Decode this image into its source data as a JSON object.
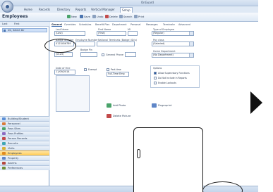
{
  "window": {
    "title": "OnGuard"
  },
  "ribbon": {
    "tabs": [
      "Home",
      "Records",
      "Directory",
      "Reports",
      "Vertical Manager",
      "Setup"
    ],
    "active_tab": "Setup",
    "toolbar": [
      "New",
      "Save",
      "Undo",
      "Delete",
      "Search",
      "Print"
    ]
  },
  "page": {
    "heading": "Employees"
  },
  "sidebar": {
    "header": [
      "Last",
      "First"
    ],
    "tree_selected": "Dir, Select Dir",
    "nav": [
      {
        "label": "Building/Student",
        "color": "#5b8fd6"
      },
      {
        "label": "Personnel",
        "color": "#d97a3a"
      },
      {
        "label": "Pass Sites",
        "color": "#4aa36a"
      },
      {
        "label": "Pass Profiles",
        "color": "#8c6bc2"
      },
      {
        "label": "Person Records",
        "color": "#c24b4b"
      },
      {
        "label": "Recruits",
        "color": "#3fa7b5"
      },
      {
        "label": "Visits",
        "color": "#d6b23a"
      },
      {
        "label": "Employees",
        "color": "#e08a1f",
        "selected": true
      },
      {
        "label": "Property",
        "color": "#5f86c7"
      },
      {
        "label": "Alarms",
        "color": "#b5473f"
      },
      {
        "label": "Preferences",
        "color": "#6f8f3a"
      }
    ]
  },
  "form": {
    "tabs": [
      "General",
      "Overrides",
      "Schedules",
      "Benefit Plan",
      "Department",
      "Personal",
      "Messages",
      "Terminate",
      "Advanced"
    ],
    "active_tab": "General",
    "last_name_label": "Last Name",
    "last_name": "(Last)",
    "first_name_label": "First Name",
    "first_name": "(First)",
    "mi_label": "MI",
    "employee_type_label": "Type of Employee",
    "employee_type": "(Regular)",
    "badge_label": "Badge Number",
    "badge_value": "0123456789",
    "employee_number_label": "Employee Number",
    "national_id_label": "National Terminals (Badge) ID(s)",
    "pay_class_label": "Pay class",
    "pay_class": "(Salaried)",
    "badge_pin_label": "Badge Pin",
    "badge_pin": "(0123)",
    "general_phone_label": "General Phone",
    "home_dept_label": "Home Department",
    "home_dept": "(No Department)",
    "date_of_hire_label": "Date of Hire",
    "date_of_hire": "11/09/2014",
    "exempt_label": "Exempt",
    "part_time_label": "Part-time",
    "full_time_label": "Full-Time Emp",
    "options_title": "Options",
    "options": [
      "Allow Supervisory Functions",
      "Do Not Include in Reports",
      "Enable Lockouts"
    ],
    "add_photo": "Add Photo",
    "delete_picture": "Delete Picture",
    "fingerprint": "Fingerprint"
  }
}
